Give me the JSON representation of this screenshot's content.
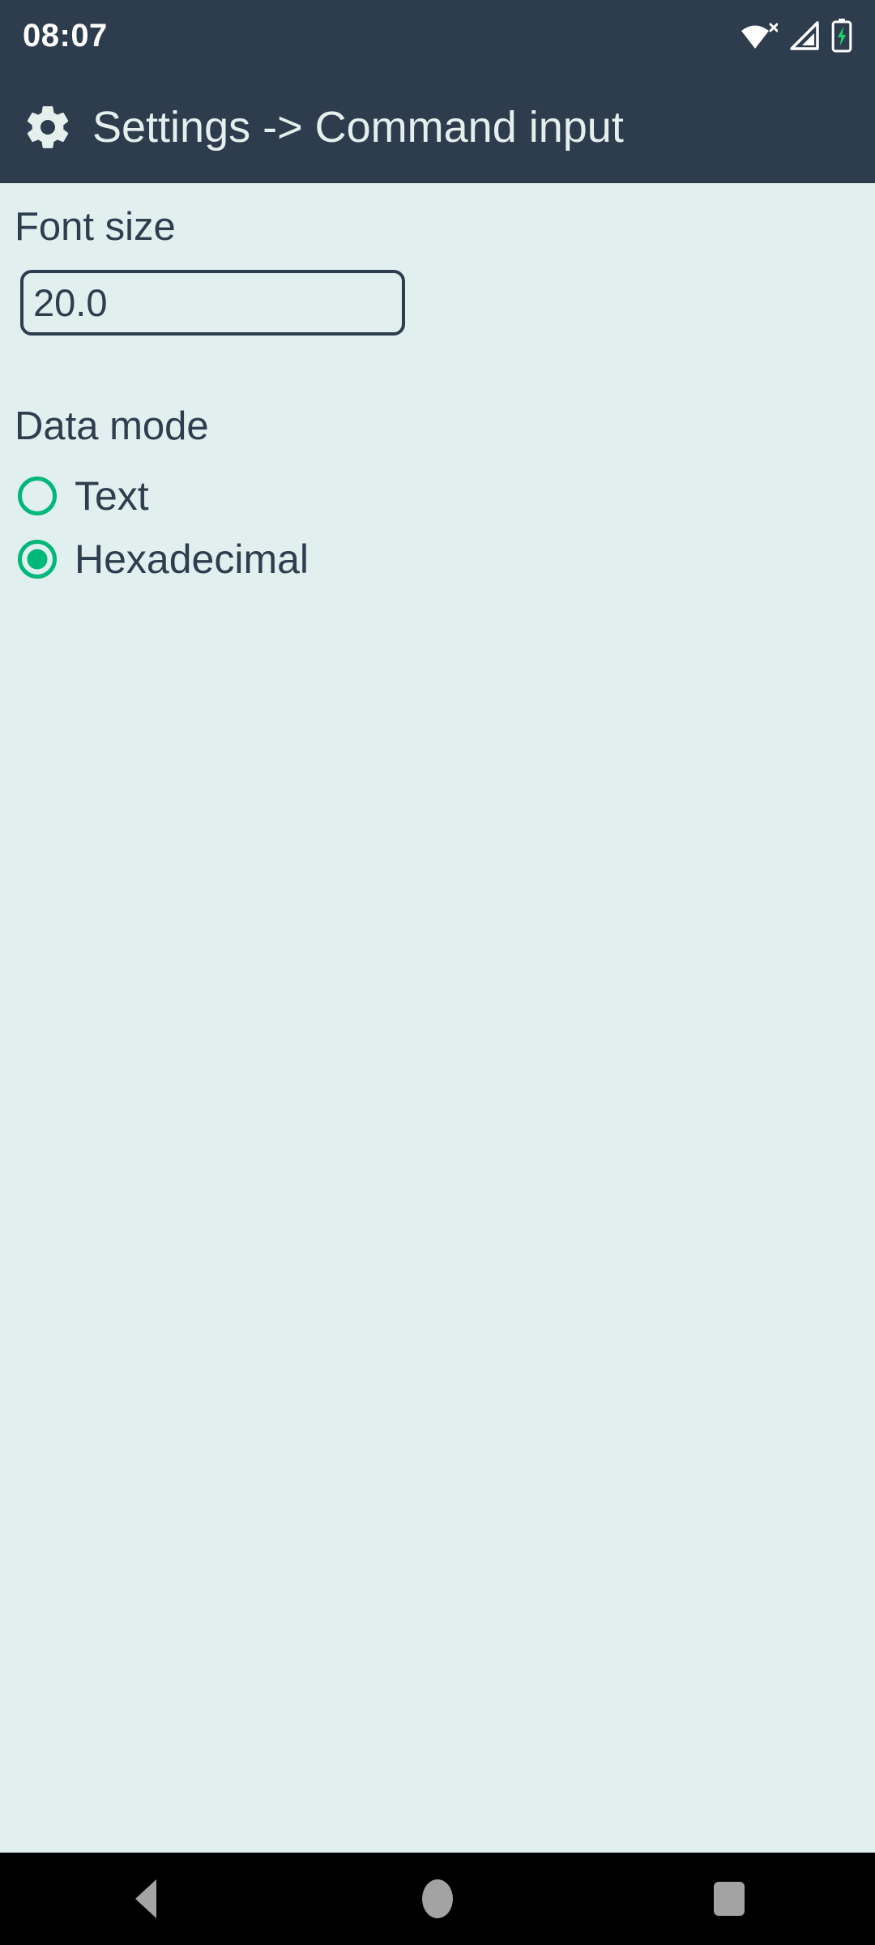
{
  "status_bar": {
    "time": "08:07",
    "icons": [
      {
        "name": "wifi-no-internet-icon",
        "label": "Wi-Fi no internet"
      },
      {
        "name": "cellular-signal-icon",
        "label": "Cellular signal"
      },
      {
        "name": "battery-charging-icon",
        "label": "Battery charging"
      }
    ]
  },
  "app_bar": {
    "icon": "gear-icon",
    "title": "Settings -> Command input"
  },
  "form": {
    "font_size": {
      "label": "Font size",
      "value": "20.0",
      "placeholder": "Font size"
    },
    "data_mode": {
      "label": "Data mode",
      "selected": "Hexadecimal",
      "options": [
        {
          "label": "Text",
          "checked": false
        },
        {
          "label": "Hexadecimal",
          "checked": true
        }
      ]
    }
  },
  "nav_bar": {
    "buttons": [
      {
        "name": "back-button",
        "label": "Back"
      },
      {
        "name": "home-button",
        "label": "Home"
      },
      {
        "name": "recents-button",
        "label": "Recents"
      }
    ]
  },
  "colors": {
    "app_bar": "#2E3D4D",
    "background": "#E2EFEF",
    "accent_green": "#00B877",
    "text_dark": "#2D3E4E",
    "nav_bar": "#000000",
    "nav_icon": "#A3A3A3"
  }
}
